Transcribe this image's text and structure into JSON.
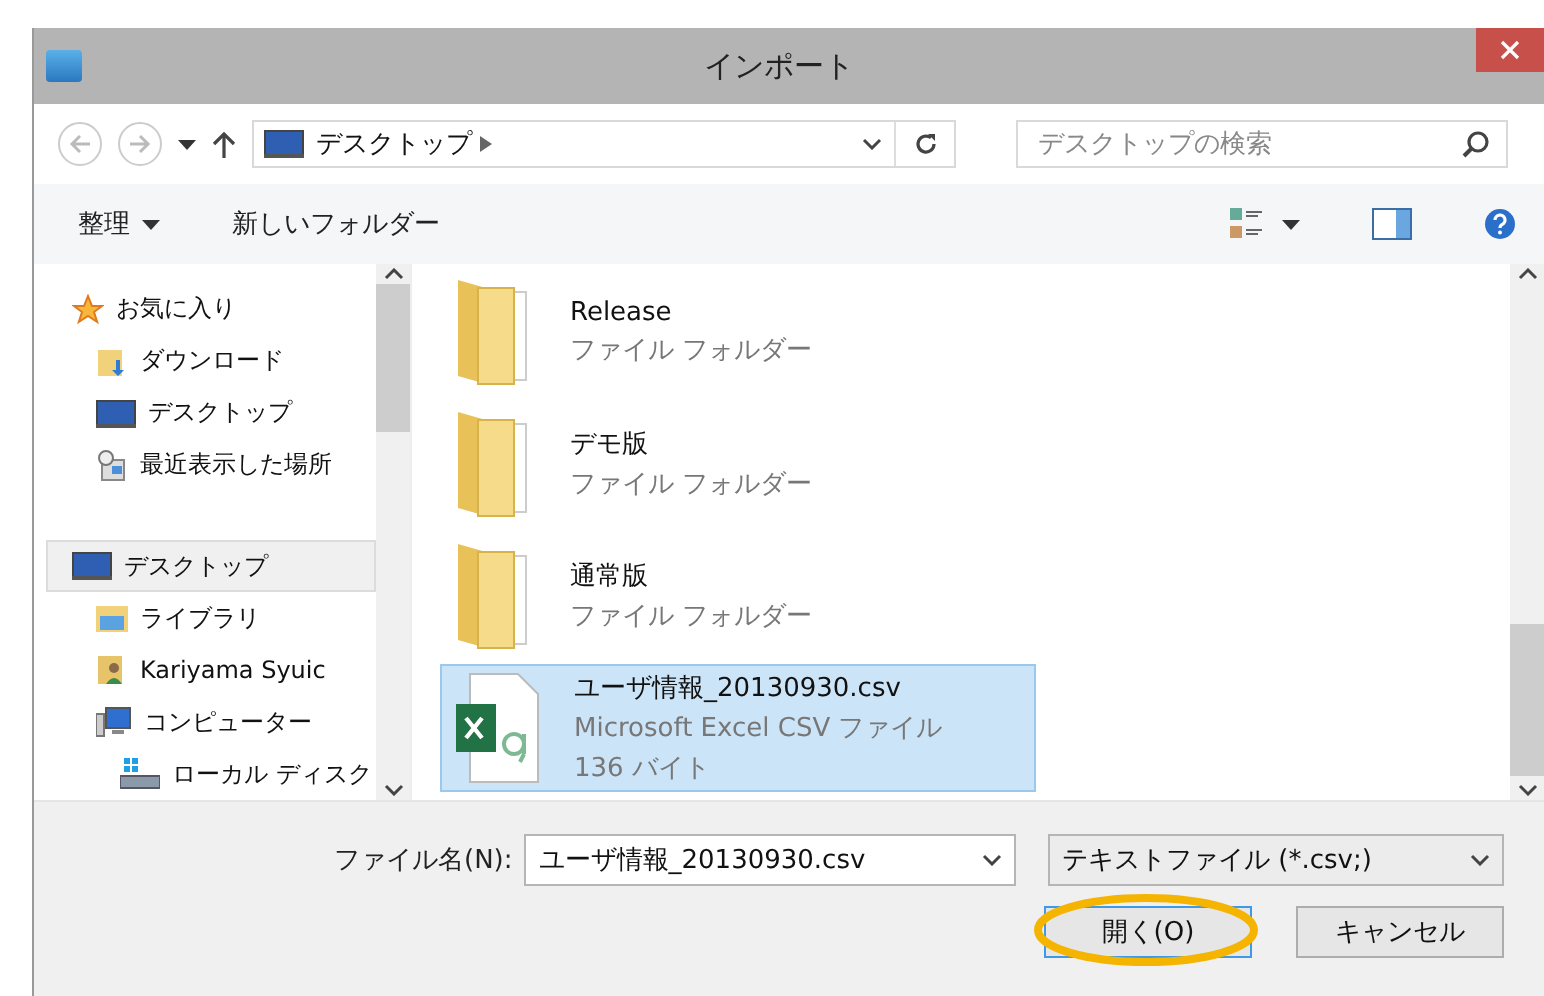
{
  "window": {
    "title": "インポート"
  },
  "nav": {
    "path": "デスクトップ",
    "search_placeholder": "デスクトップの検索"
  },
  "toolbar": {
    "organize": "整理",
    "new_folder": "新しいフォルダー"
  },
  "sidebar": {
    "groups": [
      {
        "label": "お気に入り",
        "kind": "star",
        "selected": false,
        "children": [
          {
            "label": "ダウンロード",
            "kind": "download"
          },
          {
            "label": "デスクトップ",
            "kind": "desktop"
          },
          {
            "label": "最近表示した場所",
            "kind": "recent"
          }
        ]
      },
      {
        "label": "デスクトップ",
        "kind": "desktop",
        "selected": true,
        "children": [
          {
            "label": "ライブラリ",
            "kind": "library"
          },
          {
            "label": "Kariyama Syuic",
            "kind": "user"
          },
          {
            "label": "コンピューター",
            "kind": "computer",
            "children": [
              {
                "label": "ローカル ディスク",
                "kind": "disk"
              }
            ]
          }
        ]
      }
    ]
  },
  "files": [
    {
      "kind": "folder",
      "name": "Release",
      "type": "ファイル フォルダー",
      "selected": false
    },
    {
      "kind": "folder",
      "name": "デモ版",
      "type": "ファイル フォルダー",
      "selected": false
    },
    {
      "kind": "folder",
      "name": "通常版",
      "type": "ファイル フォルダー",
      "selected": false
    },
    {
      "kind": "csv",
      "name": "ユーザ情報_20130930.csv",
      "type": "Microsoft Excel CSV ファイル",
      "size": "136 バイト",
      "selected": true
    }
  ],
  "footer": {
    "filename_label": "ファイル名(N):",
    "filename": "ユーザ情報_20130930.csv",
    "filter": "テキストファイル (*.csv;)",
    "open": "開く(O)",
    "cancel": "キャンセル"
  }
}
